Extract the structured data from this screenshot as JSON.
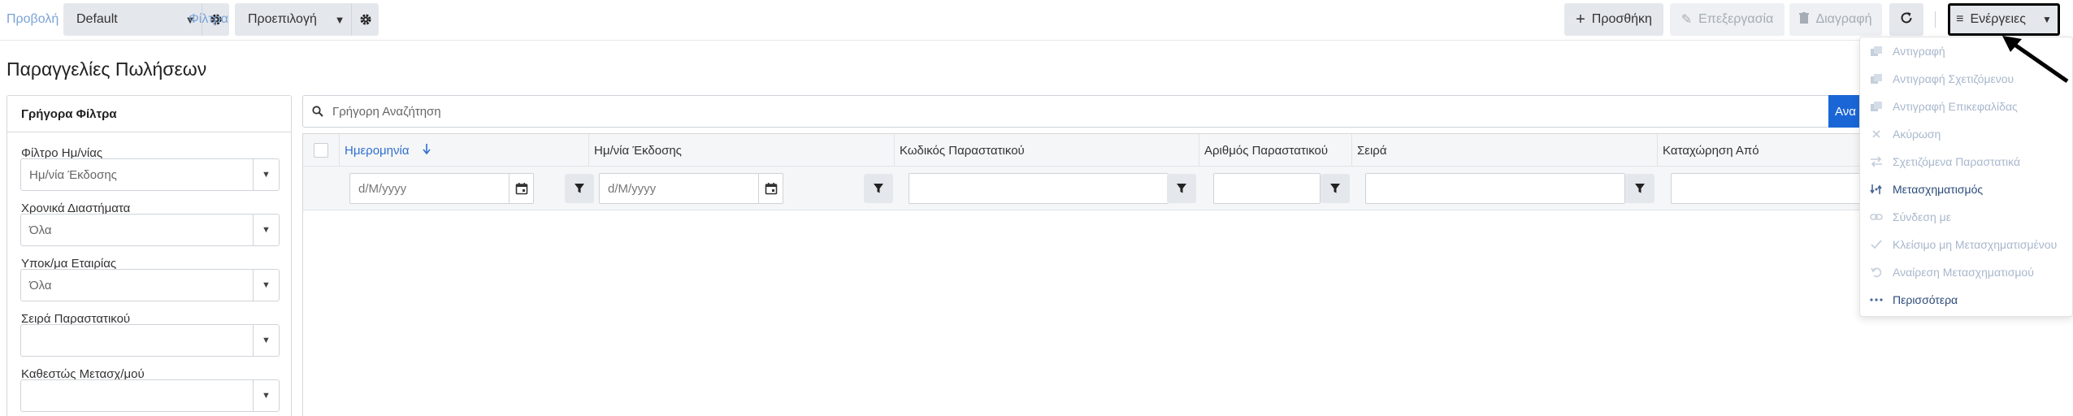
{
  "toolbar": {
    "view_label": "Προβολή",
    "view_value": "Default",
    "filters_label": "Φίλτρα",
    "filters_value": "Προεπιλογή",
    "add_label": "Προσθήκη",
    "edit_label": "Επεξεργασία",
    "delete_label": "Διαγραφή",
    "actions_label": "Ενέργειες",
    "accent_color": "#1a66d6"
  },
  "page": {
    "title": "Παραγγελίες Πωλήσεων"
  },
  "quick_filters": {
    "title": "Γρήγορα Φίλτρα",
    "fields": [
      {
        "label": "Φίλτρο Ημ/νίας",
        "value": "Ημ/νία Έκδοσης"
      },
      {
        "label": "Χρονικά Διαστήματα",
        "value": "Όλα"
      },
      {
        "label": "Υποκ/μα Εταιρίας",
        "value": "Όλα"
      },
      {
        "label": "Σειρά Παραστατικού",
        "value": ""
      },
      {
        "label": "Καθεστώς Μετασχ/μού",
        "value": ""
      }
    ]
  },
  "search": {
    "placeholder": "Γρήγορη Αναζήτηση",
    "button_label": "Ανα"
  },
  "grid": {
    "columns": [
      "Ημερομηνία",
      "Ημ/νία Έκδοσης",
      "Κωδικός Παραστατικού",
      "Αριθμός Παραστατικού",
      "Σειρά",
      "Καταχώρηση Από"
    ],
    "date_placeholder": "d/M/yyyy",
    "sorted_column": "Ημερομηνία",
    "sort_direction": "descending"
  },
  "actions_menu": {
    "items": [
      {
        "label": "Αντιγραφή",
        "icon": "copy-icon",
        "enabled": false
      },
      {
        "label": "Αντιγραφή Σχετιζόμενου",
        "icon": "copy-icon",
        "enabled": false
      },
      {
        "label": "Αντιγραφή Επικεφαλίδας",
        "icon": "copy-icon",
        "enabled": false
      },
      {
        "label": "Ακύρωση",
        "icon": "close-icon",
        "enabled": false
      },
      {
        "label": "Σχετιζόμενα Παραστατικά",
        "icon": "arrows-icon",
        "enabled": false
      },
      {
        "label": "Μετασχηματισμός",
        "icon": "transform-icon",
        "enabled": true
      },
      {
        "label": "Σύνδεση με",
        "icon": "link-icon",
        "enabled": false
      },
      {
        "label": "Κλείσιμο μη Μετασχηματισμένου",
        "icon": "check-icon",
        "enabled": false
      },
      {
        "label": "Αναίρεση Μετασχηματισμού",
        "icon": "undo-icon",
        "enabled": false
      },
      {
        "label": "Περισσότερα",
        "icon": "ellipsis-icon",
        "enabled": true
      }
    ]
  }
}
